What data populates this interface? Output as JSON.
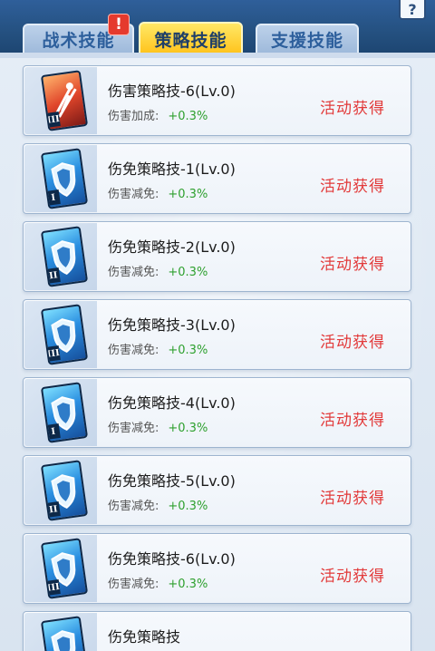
{
  "tabs": [
    {
      "label": "战术技能",
      "state": "inactive"
    },
    {
      "label": "策略技能",
      "state": "active"
    },
    {
      "label": "支援技能",
      "state": "inactive"
    }
  ],
  "alert_badge": "!",
  "help_icon": "?",
  "skills": [
    {
      "name": "伤害策略技-6(Lv.0)",
      "stat_label": "伤害加成:",
      "stat_value": "+0.3%",
      "obtain": "活动获得",
      "icon": "sword-icon",
      "tier": "III",
      "color": "red"
    },
    {
      "name": "伤免策略技-1(Lv.0)",
      "stat_label": "伤害减免:",
      "stat_value": "+0.3%",
      "obtain": "活动获得",
      "icon": "shield-icon",
      "tier": "I",
      "color": "blue"
    },
    {
      "name": "伤免策略技-2(Lv.0)",
      "stat_label": "伤害减免:",
      "stat_value": "+0.3%",
      "obtain": "活动获得",
      "icon": "shield-icon",
      "tier": "II",
      "color": "blue"
    },
    {
      "name": "伤免策略技-3(Lv.0)",
      "stat_label": "伤害减免:",
      "stat_value": "+0.3%",
      "obtain": "活动获得",
      "icon": "shield-icon",
      "tier": "III",
      "color": "blue"
    },
    {
      "name": "伤免策略技-4(Lv.0)",
      "stat_label": "伤害减免:",
      "stat_value": "+0.3%",
      "obtain": "活动获得",
      "icon": "shield-icon",
      "tier": "I",
      "color": "blue"
    },
    {
      "name": "伤免策略技-5(Lv.0)",
      "stat_label": "伤害减免:",
      "stat_value": "+0.3%",
      "obtain": "活动获得",
      "icon": "shield-icon",
      "tier": "II",
      "color": "blue"
    },
    {
      "name": "伤免策略技-6(Lv.0)",
      "stat_label": "伤害减免:",
      "stat_value": "+0.3%",
      "obtain": "活动获得",
      "icon": "shield-icon",
      "tier": "III",
      "color": "blue"
    },
    {
      "name": "伤免策略技",
      "stat_label": "",
      "stat_value": "",
      "obtain": "",
      "icon": "shield-icon",
      "tier": "",
      "color": "blue"
    }
  ],
  "colors": {
    "accent_tab": "#ffc21a",
    "obtain_text": "#e23a3a",
    "stat_value": "#2ea02e",
    "header_bg": "#24507f"
  }
}
